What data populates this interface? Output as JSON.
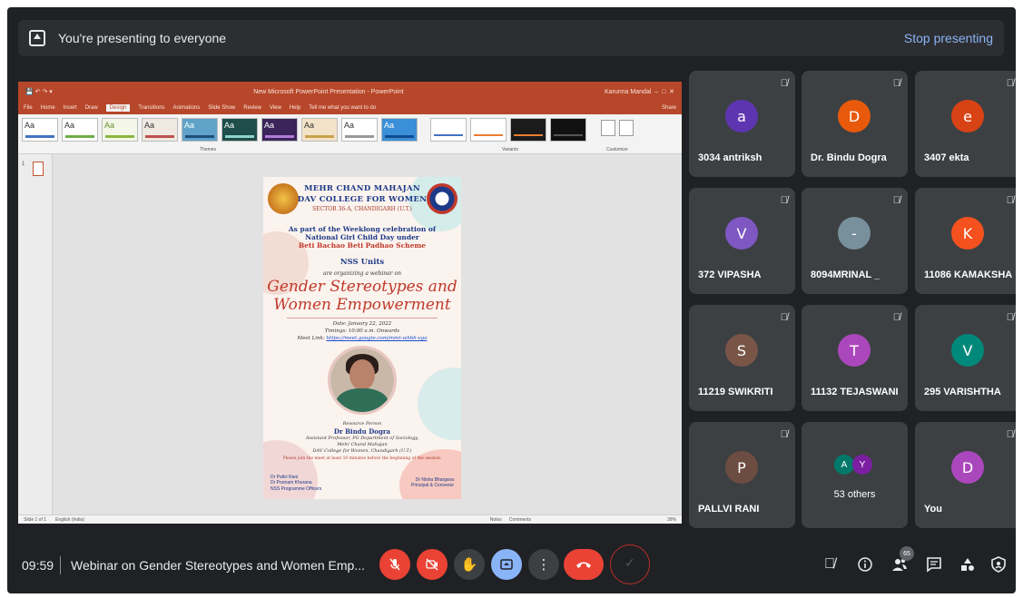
{
  "banner": {
    "text": "You're presenting to everyone",
    "stop_label": "Stop presenting"
  },
  "powerpoint": {
    "window_title": "New Microsoft PowerPoint Presentation - PowerPoint",
    "user": "Karunna Mandal",
    "tabs": [
      "File",
      "Home",
      "Insert",
      "Draw",
      "Design",
      "Transitions",
      "Animations",
      "Slide Show",
      "Review",
      "View",
      "Help"
    ],
    "active_tab": "Design",
    "tell_me": "Tell me what you want to do",
    "share": "Share",
    "group_themes": "Themes",
    "group_variants": "Variants",
    "group_customize": "Customize",
    "slide_size": "Slide Size",
    "format_background": "Format Background",
    "slide_number": "1",
    "status_left": "Slide 1 of 1",
    "status_lang": "English (India)",
    "status_notes": "Notes",
    "status_comments": "Comments",
    "zoom": "39%"
  },
  "poster": {
    "college_line1": "MEHR CHAND MAHAJAN",
    "college_line2": "DAV COLLEGE FOR WOMEN",
    "college_line3": "SECTOR 36-A, CHANDIGARH (U.T.)",
    "intro_line1": "As part of the Weeklong celebration of",
    "intro_line2": "National Girl Child Day under",
    "intro_line3": "Beti Bachao Beti Padhao Scheme",
    "units": "NSS Units",
    "organizing": "are organizing a webinar on",
    "topic_line1": "Gender Stereotypes and",
    "topic_line2": "Women Empowerment",
    "date": "Date: January 22, 2022",
    "timings": "Timings: 10:00 a.m. Onwards",
    "meet_link_label": "Meet Link:",
    "meet_link": "https://meet.google.com/mmt-whbh-vgo",
    "resource_label": "Resource Person",
    "resource_name": "Dr Bindu Dogra",
    "resource_role1": "Assistant Professor, PG Department of Sociology,",
    "resource_role2": "Mehr Chand Mahajan",
    "resource_role3": "DAV College for Women, Chandigarh (U.T.)",
    "note": "Please join the meet at least 10 minutes before the beginning of the session.",
    "left_sig1": "Dr Pallvi Rani",
    "left_sig2": "Dr Poonam Khurana",
    "left_sig3": "NSS Programme Officers",
    "right_sig1": "Dr Nisha Bhargava",
    "right_sig2": "Principal & Convenor"
  },
  "participants": [
    {
      "name": "3034 antriksh",
      "initial": "a",
      "color": "#5e35b1"
    },
    {
      "name": "Dr. Bindu Dogra",
      "initial": "D",
      "color": "#e8590c"
    },
    {
      "name": "3407 ekta",
      "initial": "e",
      "color": "#d84315"
    },
    {
      "name": "372 VIPASHA",
      "initial": "V",
      "color": "#7e57c2"
    },
    {
      "name": "8094MRINAL _",
      "initial": "-",
      "color": "#78909c"
    },
    {
      "name": "11086 KAMAKSHA",
      "initial": "K",
      "color": "#f4511e"
    },
    {
      "name": "11219 SWIKRITI",
      "initial": "S",
      "color": "#795548"
    },
    {
      "name": "11132 TEJASWANI",
      "initial": "T",
      "color": "#ab47bc"
    },
    {
      "name": "295 VARISHTHA",
      "initial": "V",
      "color": "#00897b"
    },
    {
      "name": "PALLVI RANI",
      "initial": "P",
      "color": "#6d4c41"
    },
    {
      "name": "You",
      "initial": "D",
      "color": "#ab47bc"
    }
  ],
  "others": {
    "label": "53 others",
    "initials": [
      "A",
      "Y"
    ],
    "colors": [
      "#00796b",
      "#7b1fa2"
    ]
  },
  "meeting": {
    "time": "09:59",
    "title": "Webinar on Gender Stereotypes and Women Emp...",
    "people_count": "65"
  },
  "icons": {
    "mic_off": "mic-off-icon",
    "camera_off": "camera-off-icon",
    "raise_hand": "hand-icon",
    "present": "present-icon",
    "more": "more-icon",
    "end_call": "end-call-icon",
    "info": "info-icon",
    "people": "people-icon",
    "chat": "chat-icon",
    "activities": "activities-icon",
    "safety": "shield-icon"
  },
  "colors": {
    "meet_bg": "#202124",
    "tile_bg": "#3c4043",
    "danger": "#ea4335",
    "link": "#8ab4f8",
    "ppt_accent": "#b7472a"
  }
}
